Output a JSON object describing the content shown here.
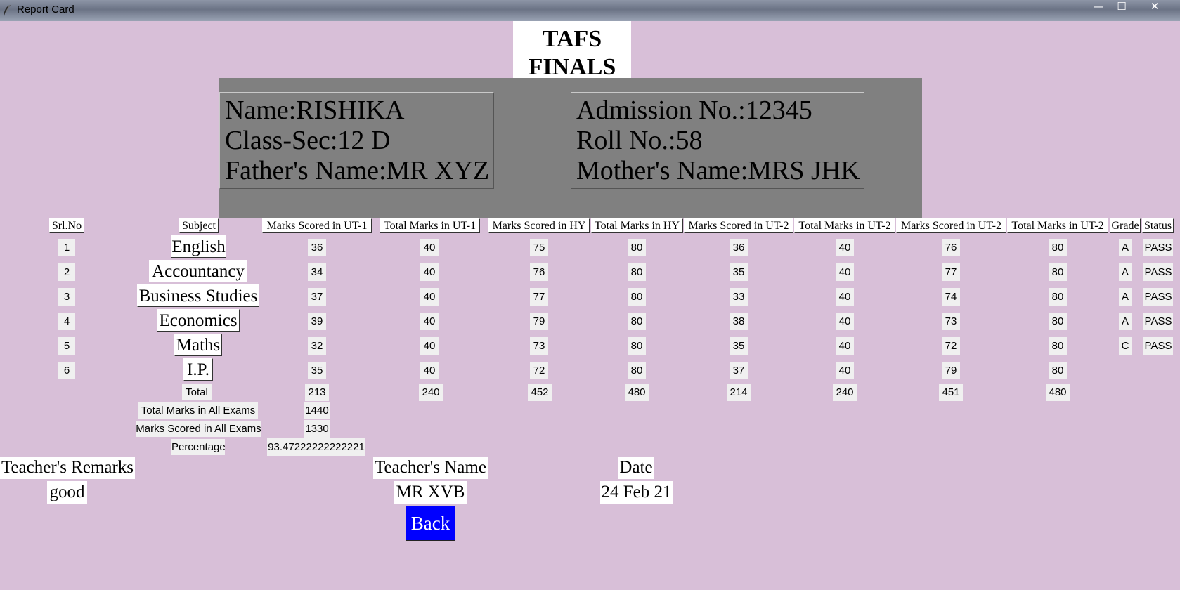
{
  "window": {
    "title": "Report Card",
    "icon": "feather-icon",
    "controls": {
      "minimize": "—",
      "maximize": "☐",
      "close": "✕"
    }
  },
  "heading": {
    "line1": "TAFS",
    "line2": "FINALS"
  },
  "student": {
    "name": "Name:RISHIKA",
    "class_sec": "Class-Sec:12 D",
    "father": "Father's Name:MR XYZ",
    "admission": "Admission No.:12345",
    "roll": "Roll No.:58",
    "mother": "Mother's Name:MRS JHK"
  },
  "columns": [
    "Srl.No",
    "Subject",
    "Marks Scored in UT-1",
    "Total Marks in UT-1",
    "Marks Scored in HY",
    "Total Marks in HY",
    "Marks Scored in UT-2",
    "Total Marks in UT-2",
    "Marks Scored in UT-2",
    "Total Marks in UT-2",
    "Grade",
    "Status"
  ],
  "rows": [
    {
      "srl": "1",
      "subject": "English",
      "ut1": "36",
      "ut1_total": "40",
      "hy": "75",
      "hy_total": "80",
      "ut2": "36",
      "ut2_total": "40",
      "final": "76",
      "final_total": "80",
      "grade": "A",
      "status": "PASS"
    },
    {
      "srl": "2",
      "subject": "Accountancy",
      "ut1": "34",
      "ut1_total": "40",
      "hy": "76",
      "hy_total": "80",
      "ut2": "35",
      "ut2_total": "40",
      "final": "77",
      "final_total": "80",
      "grade": "A",
      "status": "PASS"
    },
    {
      "srl": "3",
      "subject": "Business Studies",
      "ut1": "37",
      "ut1_total": "40",
      "hy": "77",
      "hy_total": "80",
      "ut2": "33",
      "ut2_total": "40",
      "final": "74",
      "final_total": "80",
      "grade": "A",
      "status": "PASS"
    },
    {
      "srl": "4",
      "subject": "Economics",
      "ut1": "39",
      "ut1_total": "40",
      "hy": "79",
      "hy_total": "80",
      "ut2": "38",
      "ut2_total": "40",
      "final": "73",
      "final_total": "80",
      "grade": "A",
      "status": "PASS"
    },
    {
      "srl": "5",
      "subject": "Maths",
      "ut1": "32",
      "ut1_total": "40",
      "hy": "73",
      "hy_total": "80",
      "ut2": "35",
      "ut2_total": "40",
      "final": "72",
      "final_total": "80",
      "grade": "C",
      "status": "PASS"
    },
    {
      "srl": "6",
      "subject": "I.P.",
      "ut1": "35",
      "ut1_total": "40",
      "hy": "72",
      "hy_total": "80",
      "ut2": "37",
      "ut2_total": "40",
      "final": "79",
      "final_total": "80",
      "grade": "",
      "status": ""
    }
  ],
  "totals": {
    "label": "Total",
    "ut1": "213",
    "ut1_total": "240",
    "hy": "452",
    "hy_total": "480",
    "ut2": "214",
    "ut2_total": "240",
    "final": "451",
    "final_total": "480"
  },
  "summary": {
    "total_all_label": "Total Marks in All Exams",
    "total_all": "1440",
    "scored_all_label": "Marks Scored in All Exams",
    "scored_all": "1330",
    "percentage_label": "Percentage",
    "percentage": "93.47222222222221"
  },
  "footer": {
    "remarks_label": "Teacher's Remarks",
    "remarks": "good",
    "teacher_label": "Teacher's Name",
    "teacher": "MR XVB",
    "date_label": "Date",
    "date": "24 Feb 21",
    "back": "Back"
  },
  "colors": {
    "background": "#d8bfd8",
    "info_panel": "#808080",
    "back_button": "#0000ff"
  }
}
